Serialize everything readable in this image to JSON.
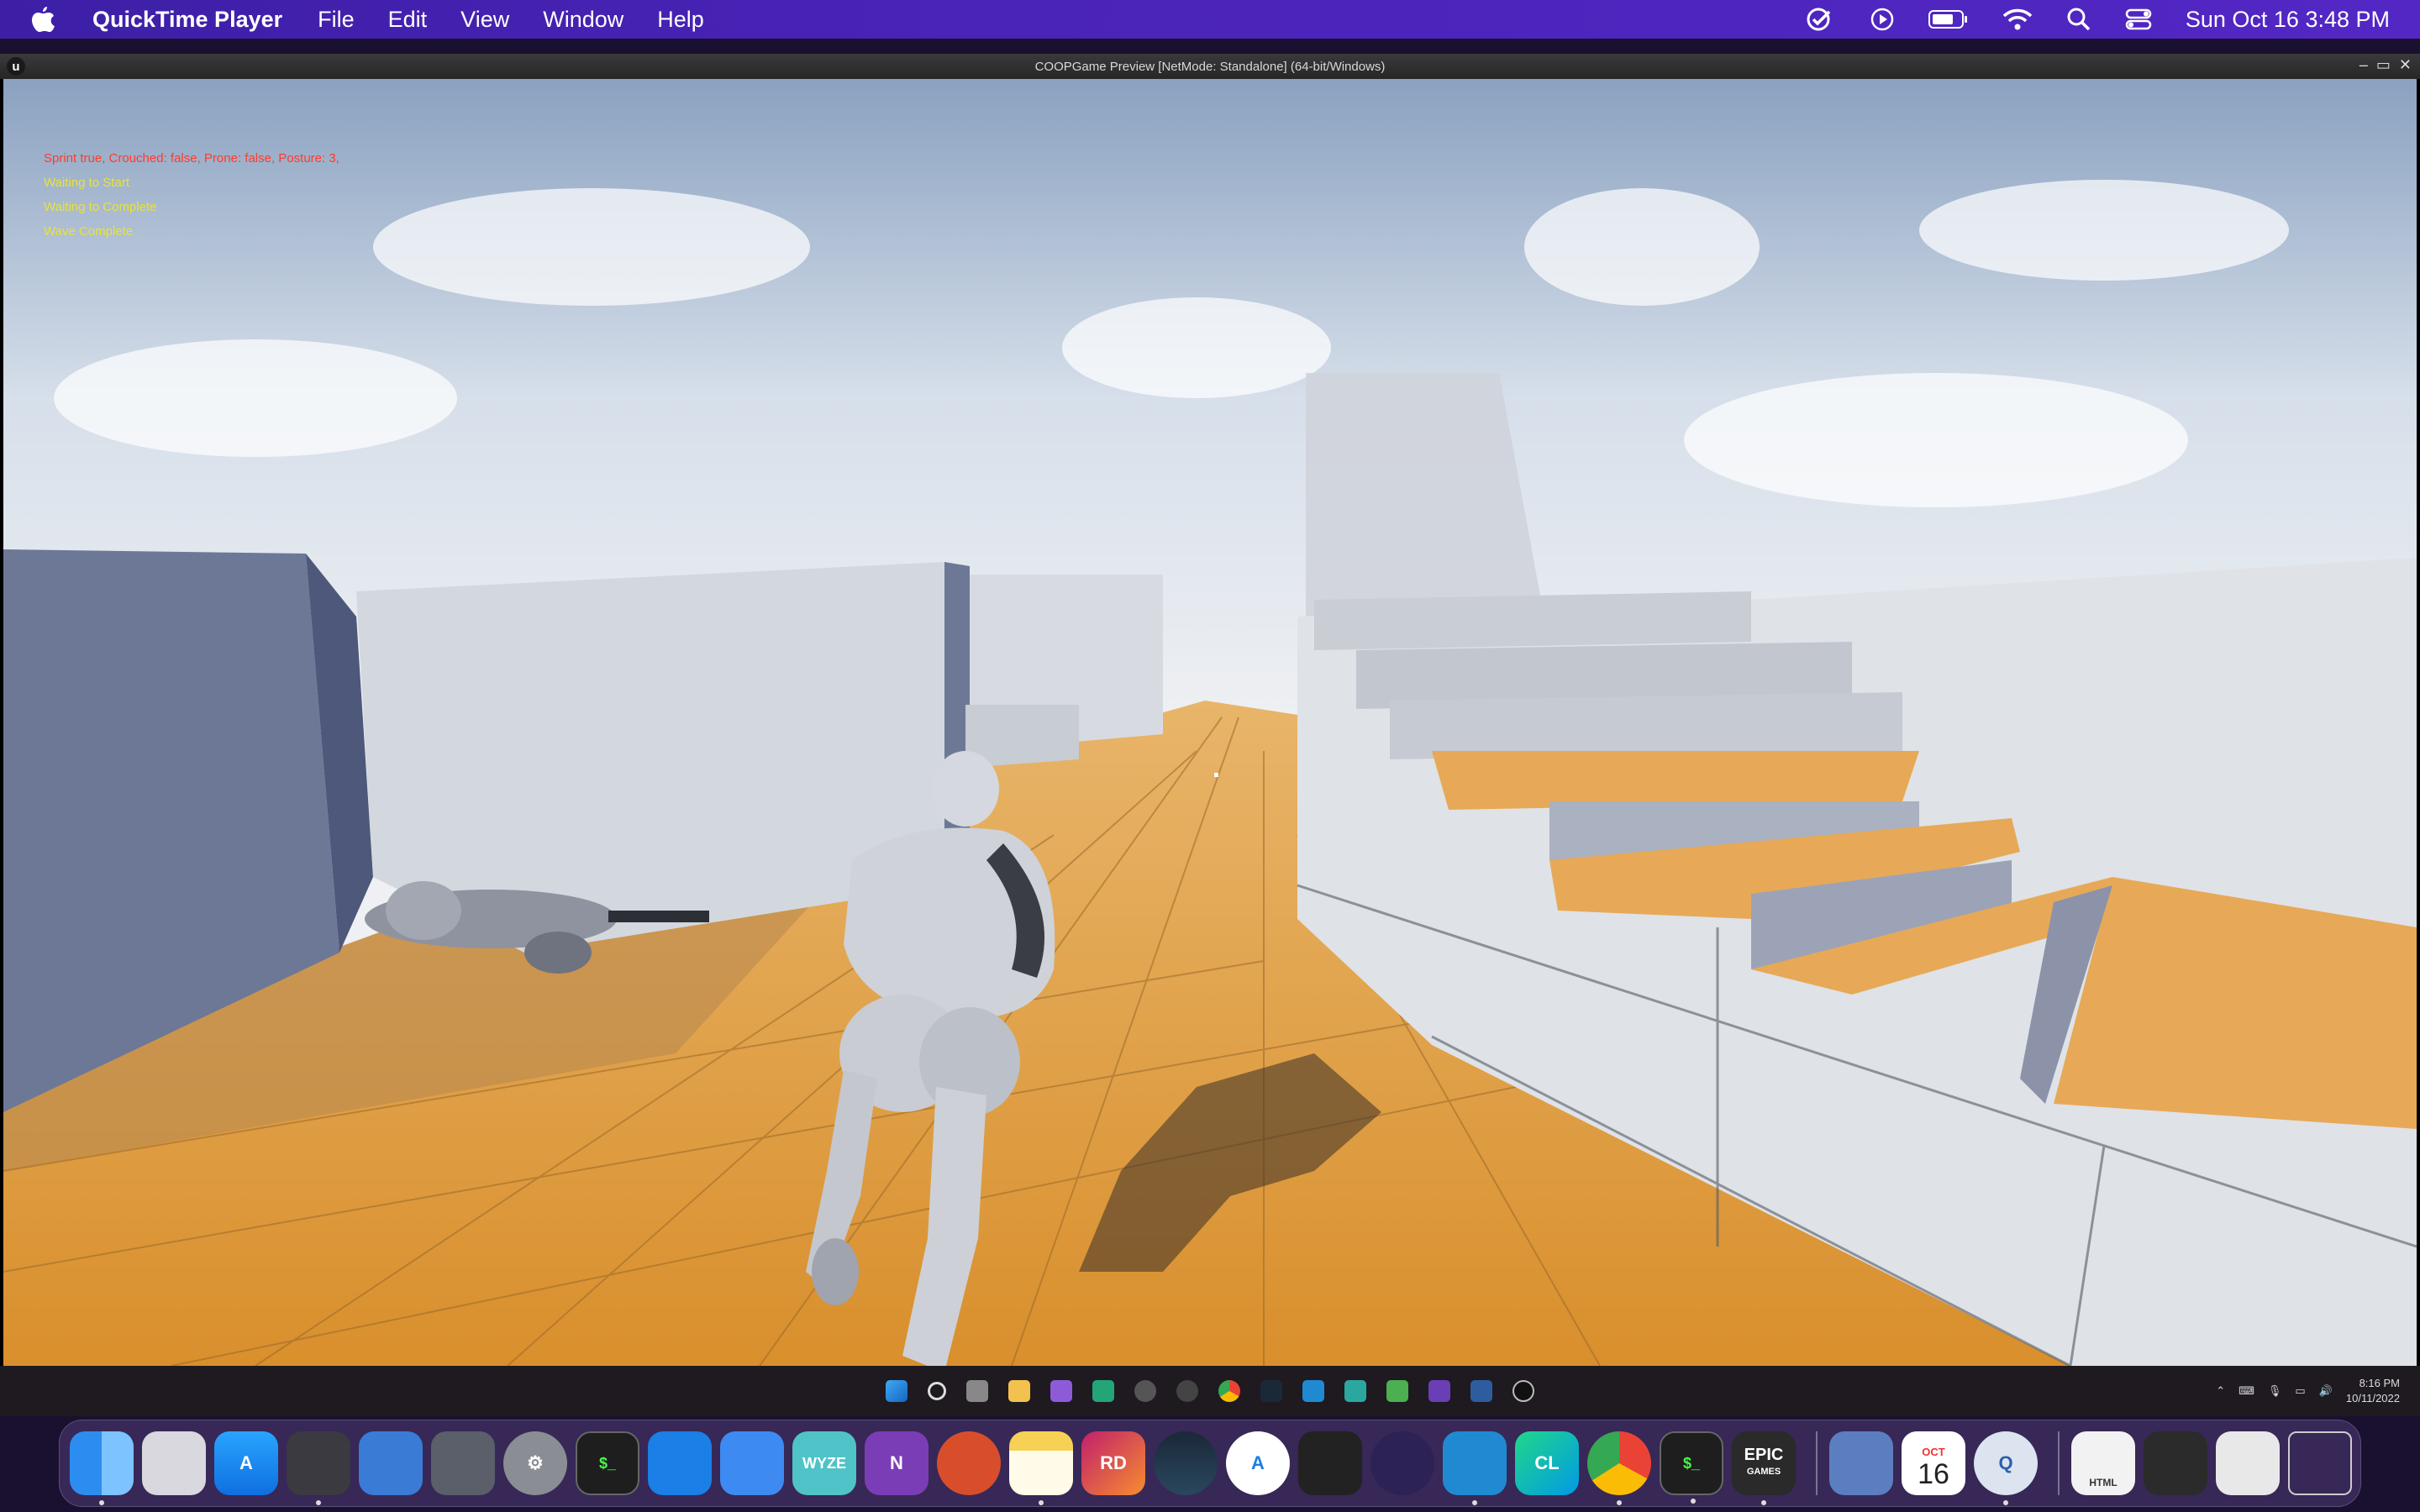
{
  "menubar": {
    "app_name": "QuickTime Player",
    "menus": [
      "File",
      "Edit",
      "View",
      "Window",
      "Help"
    ],
    "clock": "Sun Oct 16  3:48 PM"
  },
  "window": {
    "title": "COOPGame Preview [NetMode: Standalone]  (64-bit/Windows)"
  },
  "debug": {
    "line1": "Sprint true, Crouched: false, Prone: false, Posture: 3,",
    "line2": "Waiting to Start",
    "line3": "Waiting to Complete",
    "line4": "Wave Complete"
  },
  "win_taskbar": {
    "time": "8:16 PM",
    "date": "10/11/2022"
  },
  "dock": {
    "wyze_label": "WYZE",
    "rd_label": "RD",
    "cl_label": "CL",
    "epic_label": "EPIC",
    "epic_sub": "GAMES",
    "calendar_month": "OCT",
    "calendar_day": "16",
    "html_label": "HTML"
  },
  "colors": {
    "menubar": "#4a23b8",
    "floor": "#e3a24a",
    "wall": "#d9dde3"
  }
}
